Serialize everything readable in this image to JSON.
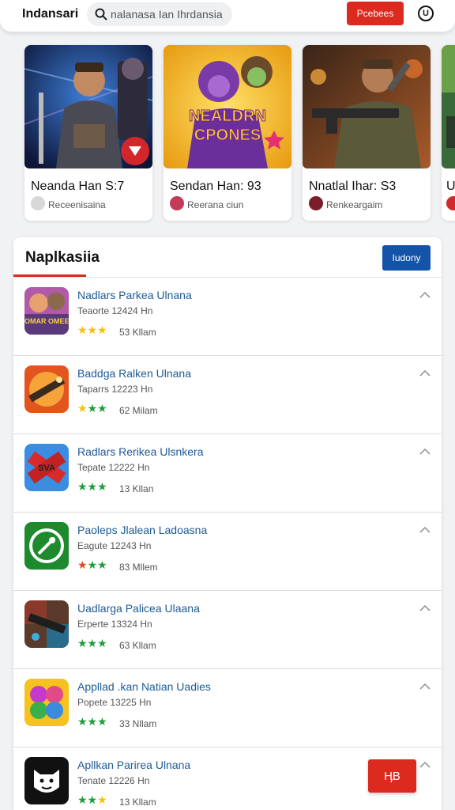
{
  "header": {
    "brand": "Indansari",
    "search_placeholder": "nalanasa Ian Ihrdansia",
    "action_label": "Pcebees",
    "user_icon_label": "U"
  },
  "featured": [
    {
      "title": "Neanda Han S:7",
      "subtitle": "Receenisaina",
      "art_text": ""
    },
    {
      "title": "Sendan Han: 93",
      "subtitle": "Reerana ciun",
      "art_text": "NEALDRN CPONES"
    },
    {
      "title": "Nnatlal Ihar: S3",
      "subtitle": "Renkeargaim",
      "art_text": ""
    },
    {
      "title": "U",
      "subtitle": "",
      "art_text": ""
    }
  ],
  "panel": {
    "title": "Naplkasiia",
    "action_label": "Iudony"
  },
  "apps": [
    {
      "name": "Nadlars Parkea Ulnana",
      "meta": "Teaorte 12424 Hn",
      "count": "53 Kllam",
      "stars": "★★★",
      "star_color": "#f2c20a",
      "icon_text": "COMAR OMEES"
    },
    {
      "name": "Baddga Ralken Ulnana",
      "meta": "Taparrs 12223 Hn",
      "count": "62 Milam",
      "stars": "★★★",
      "star_color": "#1e9b3a",
      "icon_text": ""
    },
    {
      "name": "Radlars Rerikea Ulsnkera",
      "meta": "Tepate 12222 Hn",
      "count": "13 Kllan",
      "stars": "★★★",
      "star_color": "#1e9b3a",
      "icon_text": "SVA"
    },
    {
      "name": "Paoleps Jlalean Ladoasna",
      "meta": "Eagute 12243 Hn",
      "count": "83 Mllem",
      "stars": "★★★",
      "star_color": "#1e9b3a",
      "icon_text": ""
    },
    {
      "name": "Uadlarga Palicea Ulaana",
      "meta": "Erperte 13324 Hn",
      "count": "63 Kllam",
      "stars": "★★★",
      "star_color": "#1e9b3a",
      "icon_text": ""
    },
    {
      "name": "Appllad .kan Natian Uadies",
      "meta": "Popete 13225 Hn",
      "count": "33 Nllam",
      "stars": "★★★",
      "star_color": "#1e9b3a",
      "icon_text": ""
    },
    {
      "name": "Apllkan Parirea Ulnana",
      "meta": "Tenate 12226 Hn",
      "count": "13 Kllam",
      "stars": "★★★",
      "star_color": "#1e9b3a",
      "icon_text": ""
    }
  ],
  "fab_label": "ӉB",
  "colors": {
    "accent_red": "#dc2a1f",
    "accent_blue": "#1353a8",
    "link_blue": "#1d5a96"
  }
}
